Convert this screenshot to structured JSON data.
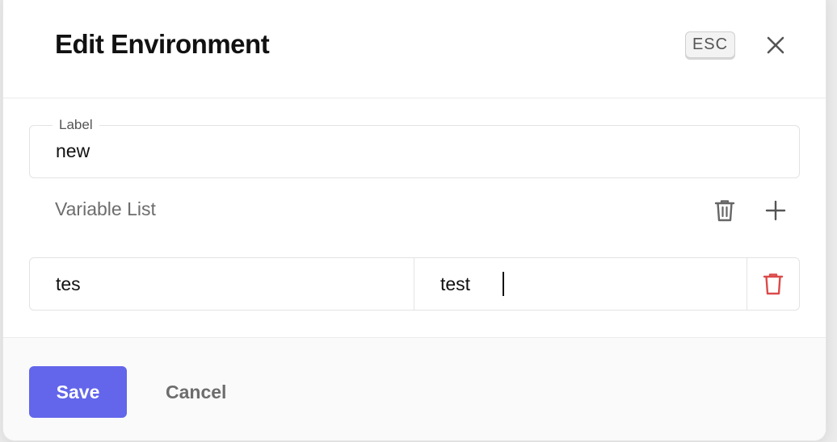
{
  "dialog": {
    "title": "Edit Environment",
    "esc_label": "ESC"
  },
  "label_field": {
    "legend": "Label",
    "value": "new"
  },
  "variable_list": {
    "title": "Variable List",
    "rows": [
      {
        "key": "tes",
        "value": "test"
      }
    ]
  },
  "footer": {
    "save_label": "Save",
    "cancel_label": "Cancel"
  },
  "icons": {
    "close": "close-icon",
    "clear_all": "trash-icon",
    "add": "plus-icon",
    "delete_row": "trash-icon"
  },
  "colors": {
    "primary": "#6366ea",
    "danger": "#dc4a4a",
    "muted_text": "#6d6d6d"
  }
}
